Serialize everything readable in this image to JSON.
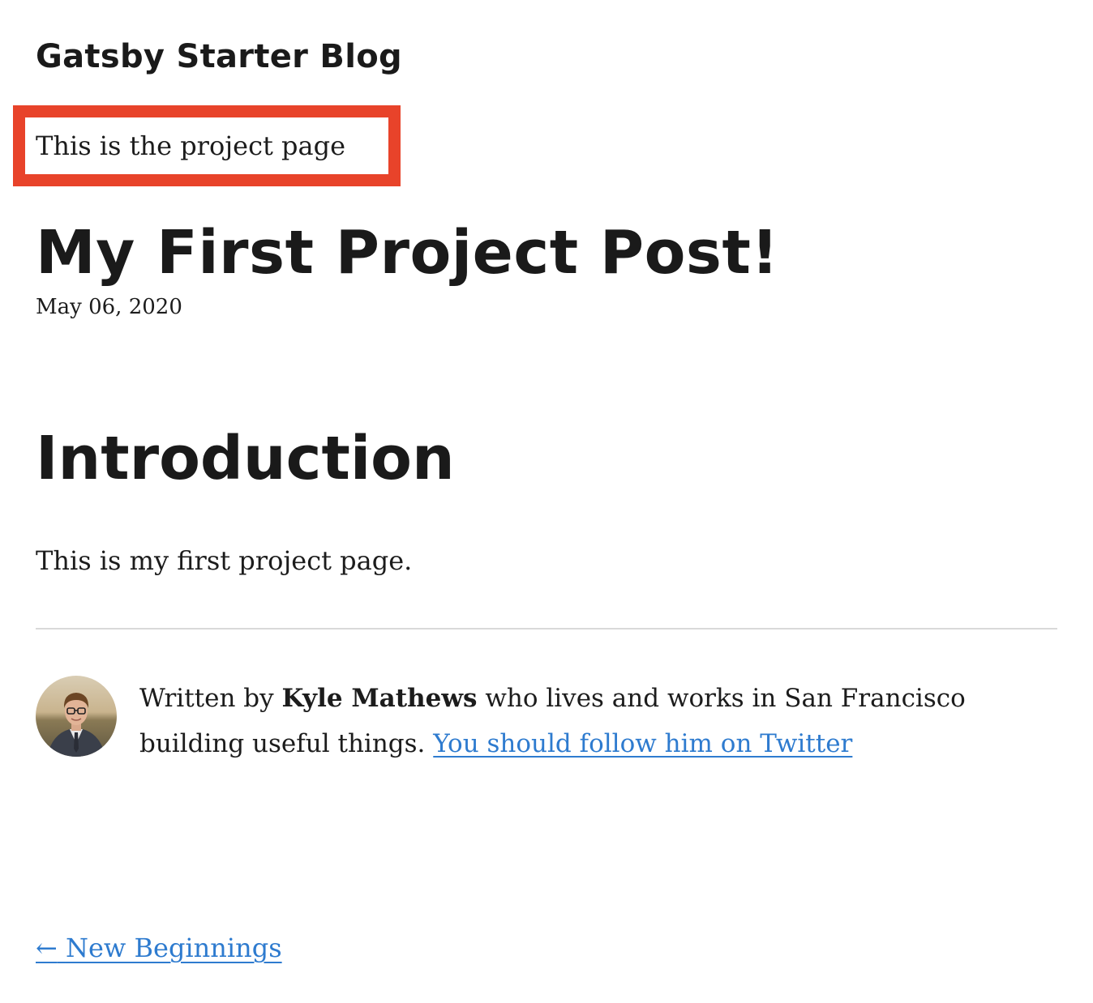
{
  "header": {
    "site_title": "Gatsby Starter Blog"
  },
  "annotation": {
    "text": "This is the project page",
    "highlight_color": "#e8432a"
  },
  "post": {
    "title": "My First Project Post!",
    "date": "May 06, 2020",
    "section_heading": "Introduction",
    "body": "This is my first project page."
  },
  "bio": {
    "avatar_icon": "author-avatar",
    "prefix": "Written by ",
    "author": "Kyle Mathews",
    "middle": " who lives and works in San Francisco building useful things. ",
    "twitter_link": "You should follow him on Twitter"
  },
  "navigation": {
    "previous_arrow": "←",
    "previous_label": "New Beginnings"
  },
  "colors": {
    "text": "#1c1c1c",
    "link": "#2e7bcf",
    "divider": "#d9d9d9"
  }
}
